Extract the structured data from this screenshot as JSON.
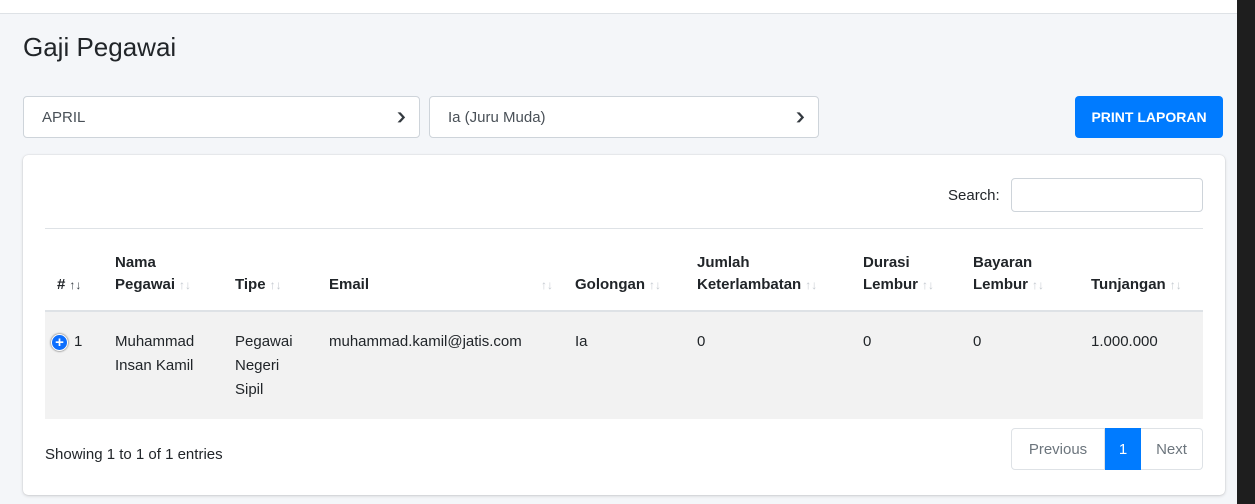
{
  "page": {
    "title": "Gaji Pegawai"
  },
  "filters": {
    "month": {
      "selected": "APRIL"
    },
    "golongan": {
      "selected": "Ia (Juru Muda)"
    }
  },
  "toolbar": {
    "print_label": "PRINT LAPORAN"
  },
  "search": {
    "label": "Search:",
    "value": ""
  },
  "table": {
    "columns": [
      {
        "line1": "",
        "line2": "#",
        "sort_active": true
      },
      {
        "line1": "Nama",
        "line2": "Pegawai"
      },
      {
        "line1": "",
        "line2": "Tipe"
      },
      {
        "line1": "",
        "line2": "Email"
      },
      {
        "line1": "",
        "line2": "Golongan"
      },
      {
        "line1": "Jumlah",
        "line2": "Keterlambatan"
      },
      {
        "line1": "Durasi",
        "line2": "Lembur"
      },
      {
        "line1": "Bayaran",
        "line2": "Lembur"
      },
      {
        "line1": "",
        "line2": "Tunjangan"
      }
    ],
    "rows": [
      {
        "no": "1",
        "nama": "Muhammad Insan Kamil",
        "tipe": "Pegawai Negeri Sipil",
        "email": "muhammad.kamil@jatis.com",
        "golongan": "Ia",
        "keterlambatan": "0",
        "durasi_lembur": "0",
        "bayaran_lembur": "0",
        "tunjangan": "1.000.000"
      }
    ]
  },
  "footer": {
    "info": "Showing 1 to 1 of 1 entries",
    "pagination": {
      "previous": "Previous",
      "current": "1",
      "next": "Next"
    }
  },
  "colors": {
    "primary": "#007bff",
    "stripe": "#f2f2f2"
  },
  "icons": {
    "expand": "plus-circle-icon",
    "dropdown": "chevron-down-icon",
    "sort": "sort-arrows-icon"
  }
}
